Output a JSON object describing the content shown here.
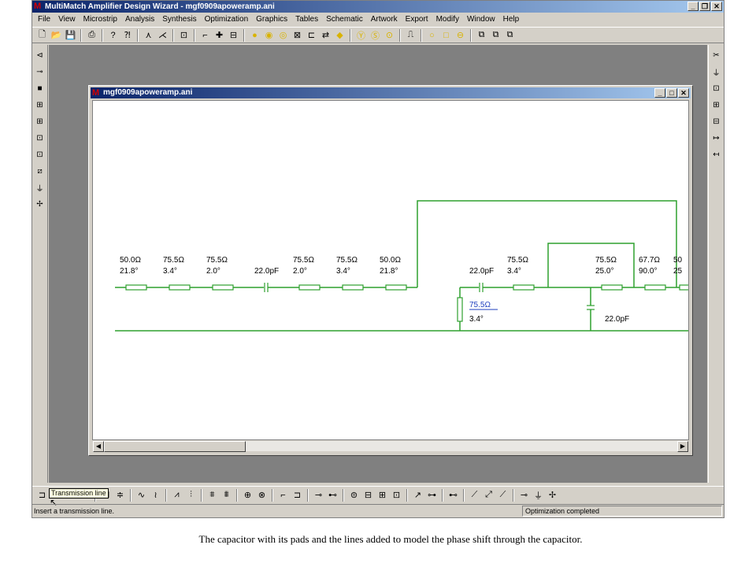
{
  "window": {
    "title": "MultiMatch Amplifier Design Wizard - mgf0909apoweramp.ani",
    "logo": "M"
  },
  "menu": [
    "File",
    "View",
    "Microstrip",
    "Analysis",
    "Synthesis",
    "Optimization",
    "Graphics",
    "Tables",
    "Schematic",
    "Artwork",
    "Export",
    "Modify",
    "Window",
    "Help"
  ],
  "child_window": {
    "title": "mgf0909apoweramp.ani",
    "logo": "M"
  },
  "schematic": {
    "wire_color": "#2ea02e",
    "elements": [
      {
        "type": "tline",
        "z": "50.0Ω",
        "angle": "21.8°"
      },
      {
        "type": "tline",
        "z": "75.5Ω",
        "angle": "3.4°"
      },
      {
        "type": "tline",
        "z": "75.5Ω",
        "angle": "2.0°"
      },
      {
        "type": "cap",
        "value": "22.0pF"
      },
      {
        "type": "tline",
        "z": "75.5Ω",
        "angle": "2.0°"
      },
      {
        "type": "tline",
        "z": "75.5Ω",
        "angle": "3.4°"
      },
      {
        "type": "tline",
        "z": "50.0Ω",
        "angle": "21.8°"
      },
      {
        "type": "cap",
        "value": "22.0pF"
      },
      {
        "type": "tline",
        "z": "75.5Ω",
        "angle": "3.4°"
      },
      {
        "type": "tline",
        "z": "75.5Ω",
        "angle": "25.0°"
      },
      {
        "type": "tline",
        "z": "67.7Ω",
        "angle": "90.0°"
      },
      {
        "type": "tline",
        "z": "50",
        "angle": "25"
      }
    ],
    "shunt_line": {
      "z": "75.5Ω",
      "angle": "3.4°"
    },
    "shunt_cap": {
      "value": "22.0pF"
    }
  },
  "tooltip": "Transmission line",
  "status": {
    "left": "Insert a transmission line.",
    "right": "Optimization completed"
  },
  "caption": "The capacitor with its pads and the lines added to model the phase shift through the capacitor."
}
